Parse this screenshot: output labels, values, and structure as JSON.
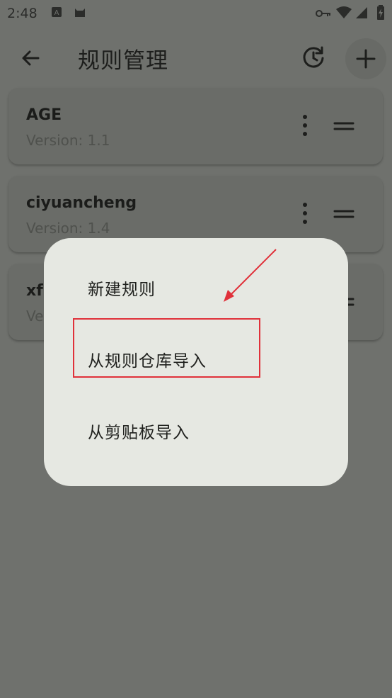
{
  "status_bar": {
    "time": "2:48"
  },
  "app_bar": {
    "title": "规则管理",
    "back_icon": "arrow-back-icon",
    "history_icon": "history-icon",
    "add_icon": "plus-icon"
  },
  "rules": [
    {
      "name": "AGE",
      "version": "Version: 1.1"
    },
    {
      "name": "ciyuancheng",
      "version": "Version: 1.4"
    },
    {
      "name": "xf",
      "version": "Ve"
    }
  ],
  "popup_menu": {
    "items": [
      {
        "label": "新建规则"
      },
      {
        "label": "从规则仓库导入"
      },
      {
        "label": "从剪贴板导入"
      }
    ]
  },
  "annotation": {
    "color": "#e0313a"
  },
  "colors": {
    "scrim_bg": "#6f716d",
    "popup_bg": "#e6e8e2"
  }
}
